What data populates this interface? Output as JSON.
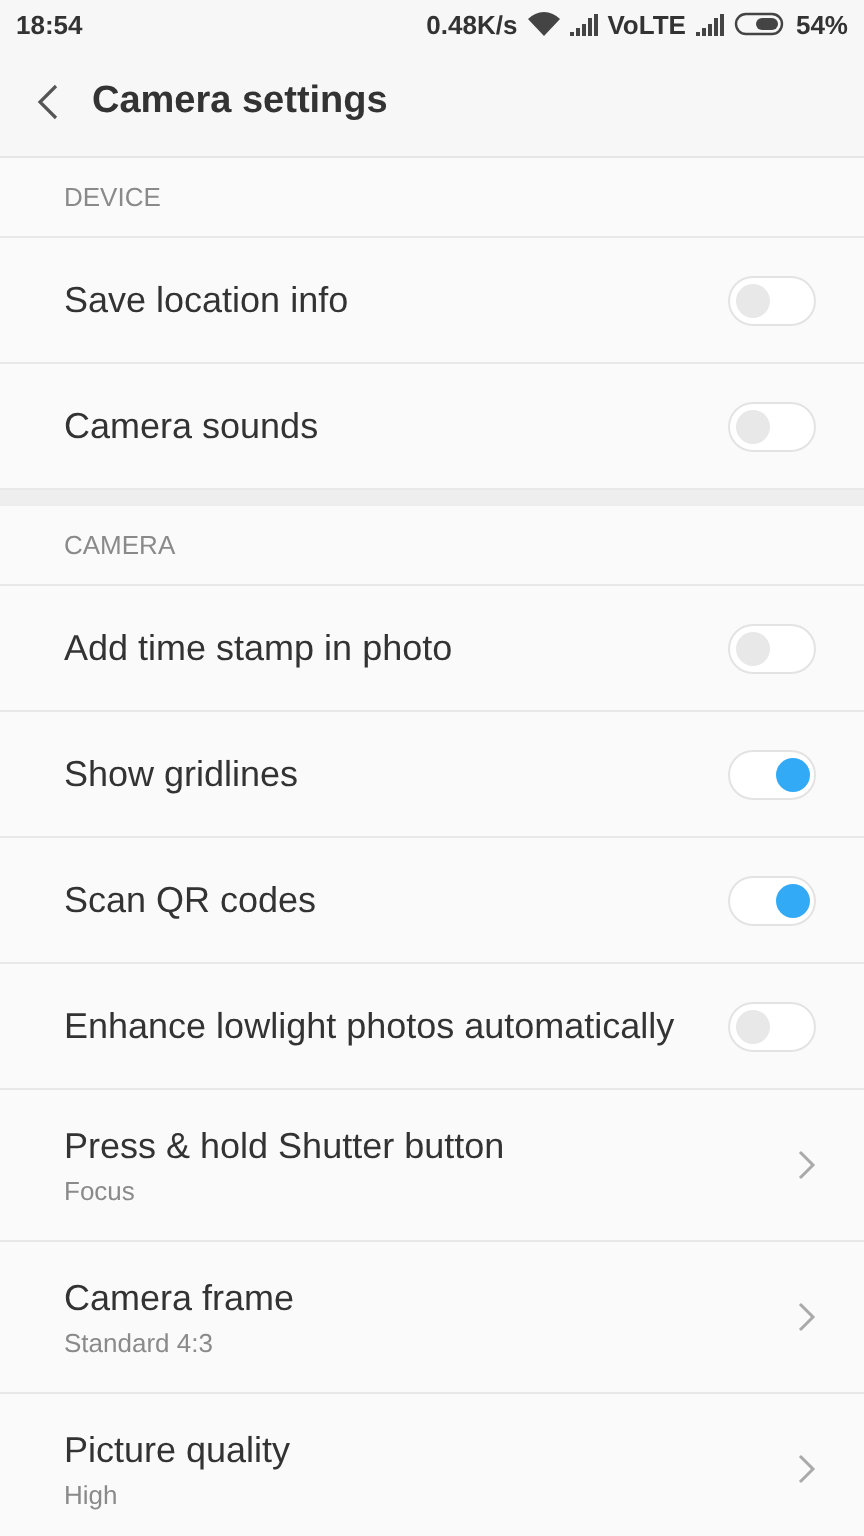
{
  "status_bar": {
    "time": "18:54",
    "speed": "0.48K/s",
    "network": "VoLTE",
    "battery": "54%"
  },
  "header": {
    "title": "Camera settings"
  },
  "sections": [
    {
      "title": "DEVICE",
      "items": [
        {
          "kind": "toggle",
          "label": "Save location info",
          "on": false
        },
        {
          "kind": "toggle",
          "label": "Camera sounds",
          "on": false
        }
      ]
    },
    {
      "title": "CAMERA",
      "items": [
        {
          "kind": "toggle",
          "label": "Add time stamp in photo",
          "on": false
        },
        {
          "kind": "toggle",
          "label": "Show gridlines",
          "on": true
        },
        {
          "kind": "toggle",
          "label": "Scan QR codes",
          "on": true
        },
        {
          "kind": "toggle",
          "label": "Enhance lowlight photos automatically",
          "on": false
        },
        {
          "kind": "link",
          "label": "Press & hold Shutter button",
          "value": "Focus"
        },
        {
          "kind": "link",
          "label": "Camera frame",
          "value": "Standard 4:3"
        },
        {
          "kind": "link",
          "label": "Picture quality",
          "value": "High"
        }
      ]
    }
  ]
}
